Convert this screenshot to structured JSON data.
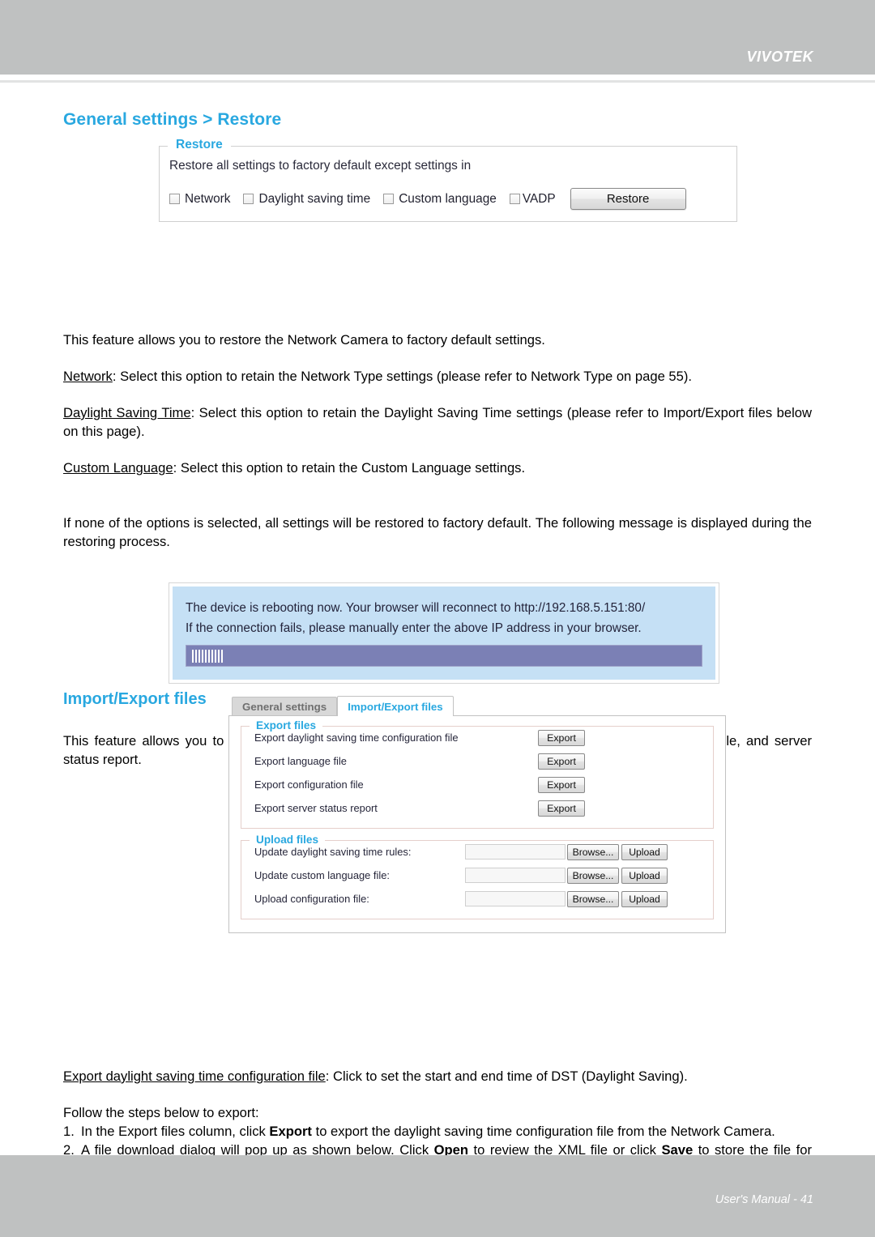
{
  "header": {
    "brand": "VIVOTEK"
  },
  "footer": {
    "text": "User's Manual - 41"
  },
  "page": {
    "title": "General settings > Restore",
    "title2": "Import/Export files"
  },
  "restore_panel": {
    "legend": "Restore",
    "description": "Restore all settings to factory default except settings in",
    "options": [
      {
        "label": "Network"
      },
      {
        "label": "Daylight saving time"
      },
      {
        "label": "Custom language"
      },
      {
        "label": "VADP"
      }
    ],
    "restore_button": "Restore"
  },
  "paragraphs": {
    "p1": "This feature allows you to restore the Network Camera to factory default settings.",
    "p2_term": "Network",
    "p2_rest": ": Select this option to retain the Network Type settings (please refer to Network Type on page 55).",
    "p3_term": "Daylight Saving Time",
    "p3_rest": ": Select this option to retain the Daylight Saving Time settings (please refer to Import/Export files below on this page).",
    "p4_term": "Custom Language",
    "p4_rest": ": Select this option to retain the Custom Language settings.",
    "p5": "If none of the options is selected, all settings will be restored to factory default.  The following message is displayed during the restoring process.",
    "p6": "This feature allows you to Export / Update daylight saving time rules, custom language file, configuration file, and server status report.",
    "p7_term": "Export daylight saving time configuration file",
    "p7_rest": ": Click to set the start and end time of DST (Daylight Saving).",
    "p8": "Follow the steps below to export:"
  },
  "reboot_dialog": {
    "line1": "The device is rebooting now. Your browser will reconnect to http://192.168.5.151:80/",
    "line2": "If the connection fails, please manually enter the above IP address in your browser.",
    "progress_color": "#7b80b5",
    "background_color": "#c5e0f5"
  },
  "ie_panel": {
    "tabs": [
      {
        "label": "General settings",
        "active": false
      },
      {
        "label": "Import/Export files",
        "active": true
      }
    ],
    "export_files": {
      "legend": "Export files",
      "rows": [
        {
          "label": "Export daylight saving time configuration file",
          "button": "Export"
        },
        {
          "label": "Export language file",
          "button": "Export"
        },
        {
          "label": "Export configuration file",
          "button": "Export"
        },
        {
          "label": "Export server status report",
          "button": "Export"
        }
      ]
    },
    "upload_files": {
      "legend": "Upload files",
      "rows": [
        {
          "label": "Update daylight saving time rules:",
          "value": "",
          "browse": "Browse...",
          "upload": "Upload"
        },
        {
          "label": "Update custom language file:",
          "value": "",
          "browse": "Browse...",
          "upload": "Upload"
        },
        {
          "label": "Upload configuration file:",
          "value": "",
          "browse": "Browse...",
          "upload": "Upload"
        }
      ]
    }
  },
  "steps": [
    {
      "num": "1.",
      "part1": "In the Export files column, click ",
      "bold1": "Export",
      "part2": " to export the daylight saving time configuration file from the Network Camera."
    },
    {
      "num": "2.",
      "part1": "A file download dialog will pop up as shown below. Click ",
      "bold1": "Open",
      "part2": " to review the XML file or click ",
      "bold2": "Save",
      "part3": " to store the file for editing."
    }
  ],
  "colors": {
    "accent": "#29a8e0",
    "band": "#bfc1c1"
  }
}
